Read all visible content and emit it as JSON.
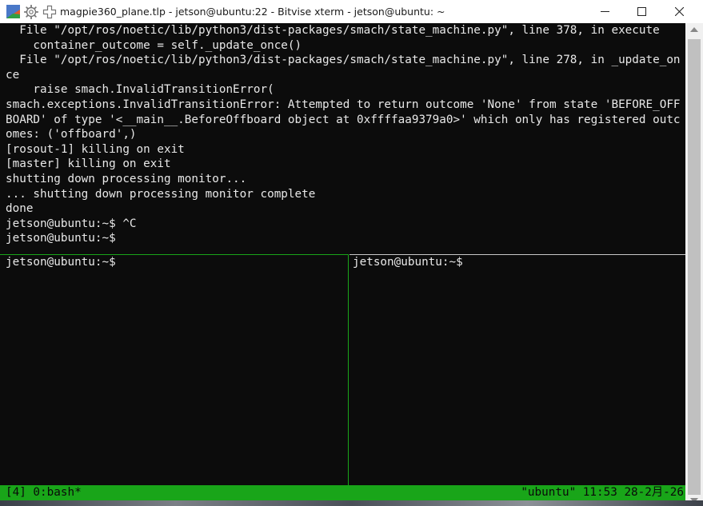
{
  "window": {
    "title": "magpie360_plane.tlp - jetson@ubuntu:22 - Bitvise xterm - jetson@ubuntu: ~",
    "icons": [
      "bitvise-app-icon",
      "gear-icon",
      "plus-icon"
    ],
    "controls": [
      "minimize-icon",
      "maximize-icon",
      "close-icon"
    ]
  },
  "terminal": {
    "top_pane_lines": [
      "  File \"/opt/ros/noetic/lib/python3/dist-packages/smach/state_machine.py\", line 378, in execute",
      "    container_outcome = self._update_once()",
      "  File \"/opt/ros/noetic/lib/python3/dist-packages/smach/state_machine.py\", line 278, in _update_on",
      "ce",
      "    raise smach.InvalidTransitionError(",
      "smach.exceptions.InvalidTransitionError: Attempted to return outcome 'None' from state 'BEFORE_OFF",
      "BOARD' of type '<__main__.BeforeOffboard object at 0xffffaa9379a0>' which only has registered outc",
      "omes: ('offboard',)",
      "[rosout-1] killing on exit",
      "[master] killing on exit",
      "shutting down processing monitor...",
      "... shutting down processing monitor complete",
      "done",
      "jetson@ubuntu:~$ ^C",
      "jetson@ubuntu:~$ "
    ],
    "bottom_left_pane_lines": [
      "jetson@ubuntu:~$ "
    ],
    "bottom_right_pane_lines": [
      "jetson@ubuntu:~$ "
    ]
  },
  "statusbar": {
    "left": "[4] 0:bash*",
    "right": "\"ubuntu\" 11:53 28-2月-26"
  },
  "colors": {
    "terminal_bg": "#0c0c0c",
    "terminal_fg": "#e8e8e8",
    "tmux_green": "#19a519",
    "titlebar_bg": "#ffffff"
  }
}
